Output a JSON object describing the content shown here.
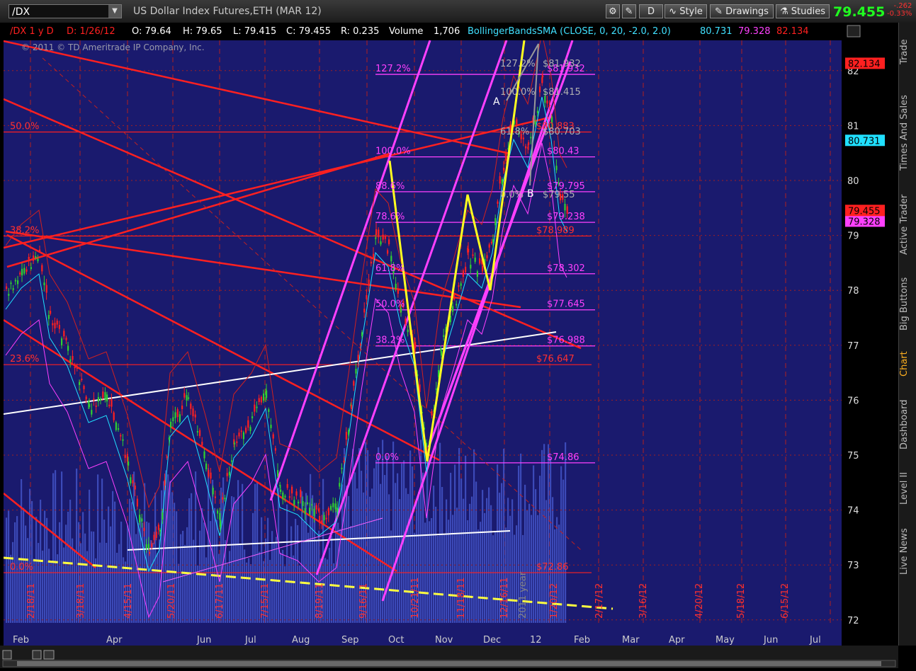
{
  "toolbar": {
    "symbol": "/DX",
    "title": "US Dollar Index Futures,ETH (MAR 12)",
    "period_button": "D",
    "style_label": "Style",
    "drawings_label": "Drawings",
    "studies_label": "Studies",
    "last_price": "79.455",
    "net_change": "-.262",
    "pct_change": "-0.33%"
  },
  "header": {
    "study_label": "/DX 1 y D",
    "date": "D: 1/26/12",
    "open": "O: 79.64",
    "high": "H: 79.65",
    "low": "L: 79.415",
    "close": "C: 79.455",
    "range": "R: 0.235",
    "volume_label": "Volume",
    "volume": "1,706",
    "bb_label": "BollingerBandsSMA (CLOSE, 0, 20, -2.0, 2.0)",
    "bb_upper": "80.731",
    "bb_mid": "79.328",
    "bb_lower": "82.134"
  },
  "copyright": "© 2011 © TD Ameritrade IP Company, Inc.",
  "right_tabs": [
    "Trade",
    "Times And Sales",
    "Active Trader",
    "Big Buttons",
    "Chart",
    "Dashboard",
    "Level II",
    "Live News"
  ],
  "price_tags": {
    "top_red": "82.134",
    "cyan": "80.731",
    "close_red": "79.455",
    "magenta": "79.328"
  },
  "chart_data": {
    "type": "line",
    "title": "US Dollar Index Futures,ETH (MAR 12)",
    "ylim": [
      72,
      82.4
    ],
    "y_ticks": [
      "82",
      "81",
      "80",
      "79",
      "78",
      "77",
      "76",
      "75",
      "74",
      "73",
      "72"
    ],
    "x_month_labels": [
      "Feb",
      "Apr",
      "Jun",
      "Jul",
      "Aug",
      "Sep",
      "Oct",
      "Nov",
      "Dec",
      "12",
      "Feb",
      "Mar",
      "Apr",
      "May",
      "Jun",
      "Jul"
    ],
    "vertical_date_labels": [
      "2/18/11",
      "3/18/11",
      "4/15/11",
      "5/20/11",
      "6/17/11",
      "7/15/11",
      "8/19/11",
      "9/16/11",
      "10/21/11",
      "11/18/11",
      "12/16/11",
      "2011 year",
      "1/20/12",
      "2/17/12",
      "3/16/12",
      "4/20/12",
      "5/18/12",
      "6/15/12"
    ],
    "fib_levels_magenta": [
      {
        "label": "127.2%",
        "price": "$81.932",
        "value": 81.932
      },
      {
        "label": "100.0%",
        "price": "$80.43",
        "value": 80.43
      },
      {
        "label": "88.6%",
        "price": "$79.795",
        "value": 79.795
      },
      {
        "label": "78.6%",
        "price": "$79.238",
        "value": 79.238
      },
      {
        "label": "61.8%",
        "price": "$78.302",
        "value": 78.302
      },
      {
        "label": "50.0%",
        "price": "$77.645",
        "value": 77.645
      },
      {
        "label": "38.2%",
        "price": "$76.988",
        "value": 76.988
      },
      {
        "label": "0.0%",
        "price": "$74.86",
        "value": 74.86
      }
    ],
    "fib_levels_red": [
      {
        "label": "50.0%",
        "price": "$80.883",
        "value": 80.883
      },
      {
        "label": "38.2%",
        "price": "$78.989",
        "value": 78.989
      },
      {
        "label": "23.6%",
        "price": "$76.647",
        "value": 76.647
      },
      {
        "label": "0.0%",
        "price": "$72.86",
        "value": 72.86
      }
    ],
    "gray_levels": [
      {
        "label": "127.2%",
        "price": "$81.932"
      },
      {
        "label": "100.0%",
        "price": "$81.415"
      },
      {
        "label": "61.8%",
        "price": "$80.703"
      },
      {
        "label": "0.0%",
        "price": "$79.55"
      }
    ],
    "pattern_points": [
      "A",
      "B"
    ],
    "colors": {
      "background": "#1a1a6e",
      "fib_magenta": "#ff40ff",
      "fib_red": "#ff2020",
      "yellow_pattern": "#ffff20",
      "volume": "#3c4ab8",
      "bb": "#ff40ff",
      "sma": "#20e0ff"
    }
  }
}
